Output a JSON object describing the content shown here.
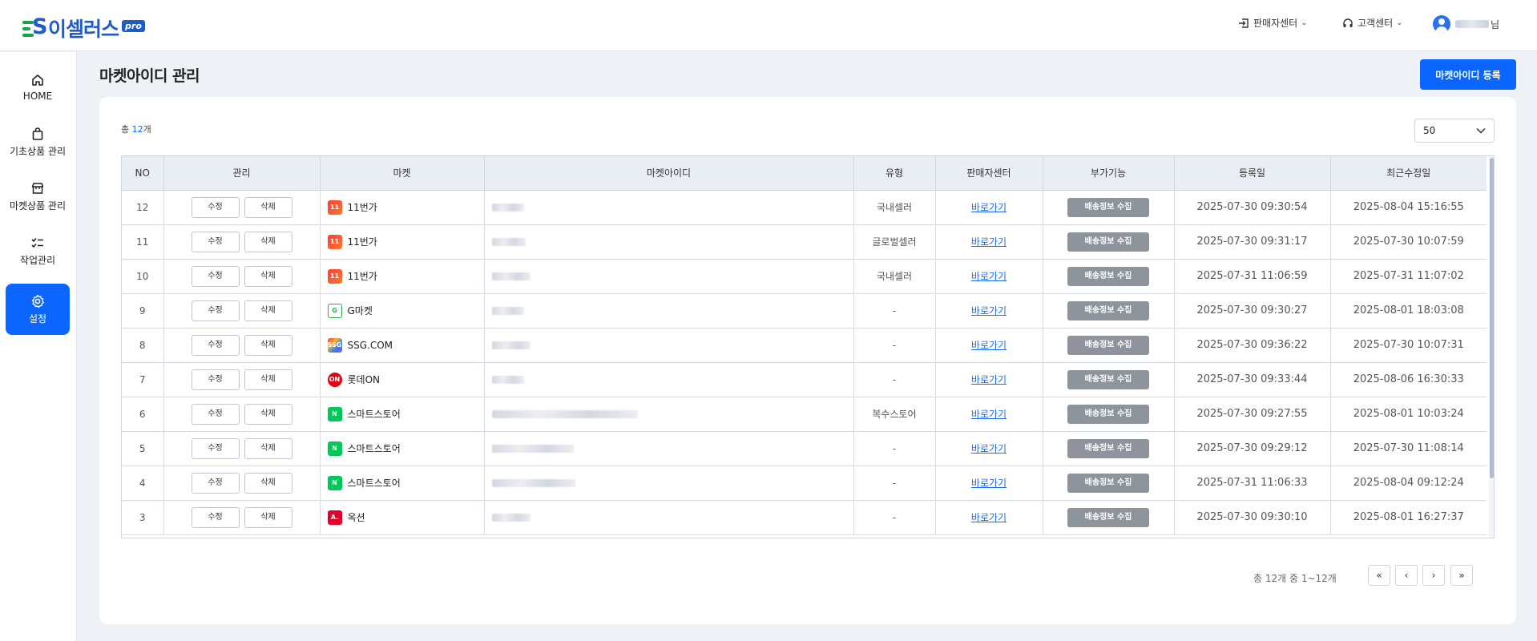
{
  "header": {
    "logo_text": "이셀러스",
    "logo_badge": "pro",
    "nav": [
      {
        "label": "판매자센터"
      },
      {
        "label": "고객센터"
      }
    ],
    "user_suffix": "님"
  },
  "sidebar": {
    "items": [
      {
        "label": "HOME",
        "icon": "home-icon"
      },
      {
        "label": "기초상품 관리",
        "icon": "bag-icon"
      },
      {
        "label": "마켓상품 관리",
        "icon": "store-icon"
      },
      {
        "label": "작업관리",
        "icon": "checklist-icon"
      },
      {
        "label": "설정",
        "icon": "gear-icon",
        "active": true
      }
    ]
  },
  "page": {
    "title": "마켓아이디 관리",
    "register_button": "마켓아이디 등록",
    "total_prefix": "총 ",
    "total_count": "12",
    "total_suffix": "개",
    "page_size": "50"
  },
  "table": {
    "columns": [
      "NO",
      "관리",
      "마켓",
      "마켓아이디",
      "유형",
      "판매자센터",
      "부가기능",
      "등록일",
      "최근수정일"
    ],
    "edit_label": "수정",
    "delete_label": "삭제",
    "link_label": "바로가기",
    "action_label": "배송정보 수집",
    "rows": [
      {
        "no": "12",
        "market": "11번가",
        "logo": "11st",
        "type": "국내셀러",
        "registered": "2025-07-30 09:30:54",
        "modified": "2025-08-04 15:16:55"
      },
      {
        "no": "11",
        "market": "11번가",
        "logo": "11st",
        "type": "글로벌셀러",
        "registered": "2025-07-30 09:31:17",
        "modified": "2025-07-30 10:07:59"
      },
      {
        "no": "10",
        "market": "11번가",
        "logo": "11st",
        "type": "국내셀러",
        "registered": "2025-07-31 11:06:59",
        "modified": "2025-07-31 11:07:02"
      },
      {
        "no": "9",
        "market": "G마켓",
        "logo": "gmarket",
        "type": "-",
        "registered": "2025-07-30 09:30:27",
        "modified": "2025-08-01 18:03:08"
      },
      {
        "no": "8",
        "market": "SSG.COM",
        "logo": "ssg",
        "type": "-",
        "registered": "2025-07-30 09:36:22",
        "modified": "2025-07-30 10:07:31"
      },
      {
        "no": "7",
        "market": "롯데ON",
        "logo": "lotteon",
        "type": "-",
        "registered": "2025-07-30 09:33:44",
        "modified": "2025-08-06 16:30:33"
      },
      {
        "no": "6",
        "market": "스마트스토어",
        "logo": "naver",
        "type": "복수스토어",
        "registered": "2025-07-30 09:27:55",
        "modified": "2025-08-01 10:03:24"
      },
      {
        "no": "5",
        "market": "스마트스토어",
        "logo": "naver",
        "type": "-",
        "registered": "2025-07-30 09:29:12",
        "modified": "2025-07-30 11:08:14"
      },
      {
        "no": "4",
        "market": "스마트스토어",
        "logo": "naver",
        "type": "-",
        "registered": "2025-07-31 11:06:33",
        "modified": "2025-08-04 09:12:24"
      },
      {
        "no": "3",
        "market": "옥션",
        "logo": "auction",
        "type": "-",
        "registered": "2025-07-30 09:30:10",
        "modified": "2025-08-01 16:27:37"
      }
    ]
  },
  "pagination": {
    "info": "총 12개 중 1~12개",
    "first": "«",
    "prev": "‹",
    "next": "›",
    "last": "»"
  },
  "colors": {
    "primary": "#0a66ff",
    "logo_blue": "#1e5cc8",
    "logo_green": "#1aa34a",
    "action_gray": "#8e949c",
    "header_bg": "#e9eef5"
  }
}
